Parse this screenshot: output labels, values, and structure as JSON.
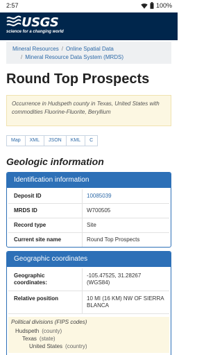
{
  "status": {
    "time": "2:57",
    "battery": "100%"
  },
  "header": {
    "logo_text": "USGS",
    "tagline": "science for a changing world"
  },
  "breadcrumbs": {
    "items": [
      "Mineral Resources",
      "Online Spatial Data",
      "Mineral Resource Data System (MRDS)"
    ],
    "separator": "/"
  },
  "page": {
    "title": "Round Top Prospects",
    "description": "Occurrence in Hudspeth county in Texas, United States with commodities Fluorine-Fluorite, Beryllium"
  },
  "formats": [
    "Map",
    "XML",
    "JSON",
    "KML",
    "C"
  ],
  "geologic": {
    "heading": "Geologic information"
  },
  "identification": {
    "heading": "Identification information",
    "rows": [
      {
        "label": "Deposit ID",
        "value": "10085039"
      },
      {
        "label": "MRDS ID",
        "value": "W700505"
      },
      {
        "label": "Record type",
        "value": "Site"
      },
      {
        "label": "Current site name",
        "value": "Round Top Prospects"
      }
    ]
  },
  "geographic": {
    "heading": "Geographic coordinates",
    "rows": [
      {
        "label": "Geographic coordinates:",
        "value": "-105.47525, 31.28267 (WGS84)"
      },
      {
        "label": "Relative position",
        "value": "10 MI (16 KM) NW OF SIERRA BLANCA"
      }
    ],
    "political": {
      "heading": "Political divisions (FIPS codes)",
      "levels": [
        {
          "name": "Hudspeth",
          "type": "(county)"
        },
        {
          "name": "Texas",
          "type": "(state)"
        },
        {
          "name": "United States",
          "type": "(country)"
        }
      ]
    }
  },
  "colors": {
    "header": "#00264c",
    "accent": "#2d70b7",
    "link": "#2e6aa8",
    "note_bg": "#fcf7e2"
  }
}
